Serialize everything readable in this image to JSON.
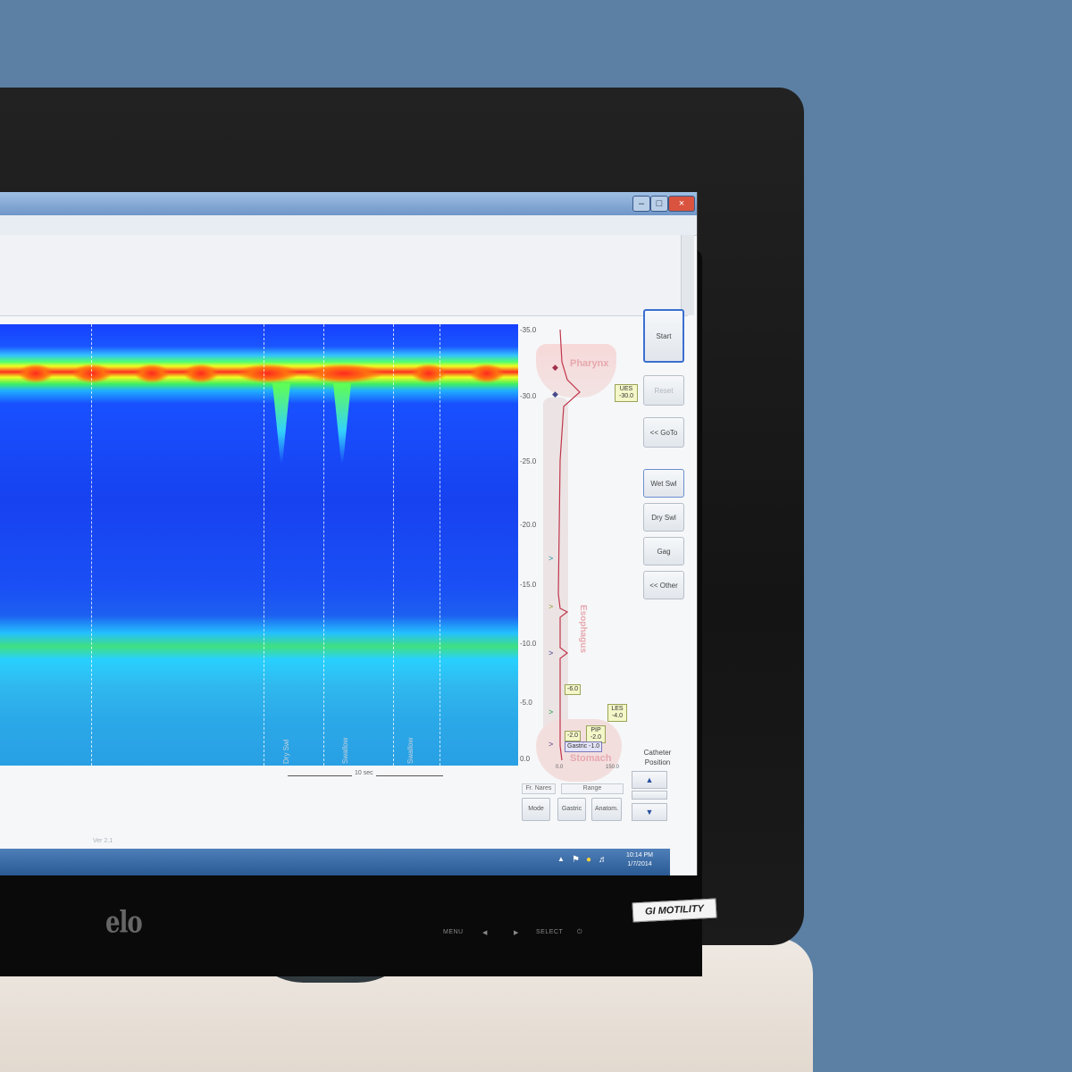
{
  "axis": {
    "ticks": [
      "-35.0",
      "-30.0",
      "-25.0",
      "-20.0",
      "-15.0",
      "-10.0",
      "-5.0",
      "0.0"
    ]
  },
  "pressure_axis": {
    "min_label": "0.0",
    "max_label": "150.0"
  },
  "anatomy": {
    "pharynx": "Pharynx",
    "esophagus": "Esophagus",
    "stomach": "Stomach"
  },
  "tags": {
    "ues_top": "UES -30.0",
    "mid": "-6.0",
    "les": "LES -4.0",
    "pip": "PIP -2.0",
    "left_low": "-2.0",
    "gastric": "Gastric -1.0"
  },
  "scale_bar": {
    "label": "10 sec"
  },
  "events": [
    "Dry Swl",
    "Swallow",
    "Swallow"
  ],
  "buttons": {
    "start": "Start",
    "reset": "Reset",
    "goto": "<< GoTo",
    "wet_swl": "Wet Swl",
    "dry_swl": "Dry Swl",
    "gag": "Gag",
    "other": "<< Other"
  },
  "catheter": {
    "label": "Catheter Position"
  },
  "lower_tabs": {
    "fr_nares": "Fr. Nares",
    "range": "Range"
  },
  "lower_buttons": {
    "mode": "Mode",
    "gastric": "Gastric",
    "anatom": "Anatom."
  },
  "version": "Ver 2.1",
  "clock": {
    "time": "10:14 PM",
    "date": "1/7/2014"
  },
  "hardware": {
    "brand": "elo",
    "menu": "MENU",
    "select": "SELECT",
    "sticker": "GI MOTILITY"
  },
  "colors": {
    "background_wall": "#5b80a4",
    "heatmap_low": "#1a50f5",
    "heatmap_high": "#ff3020",
    "taskbar": "#2a5a94"
  }
}
